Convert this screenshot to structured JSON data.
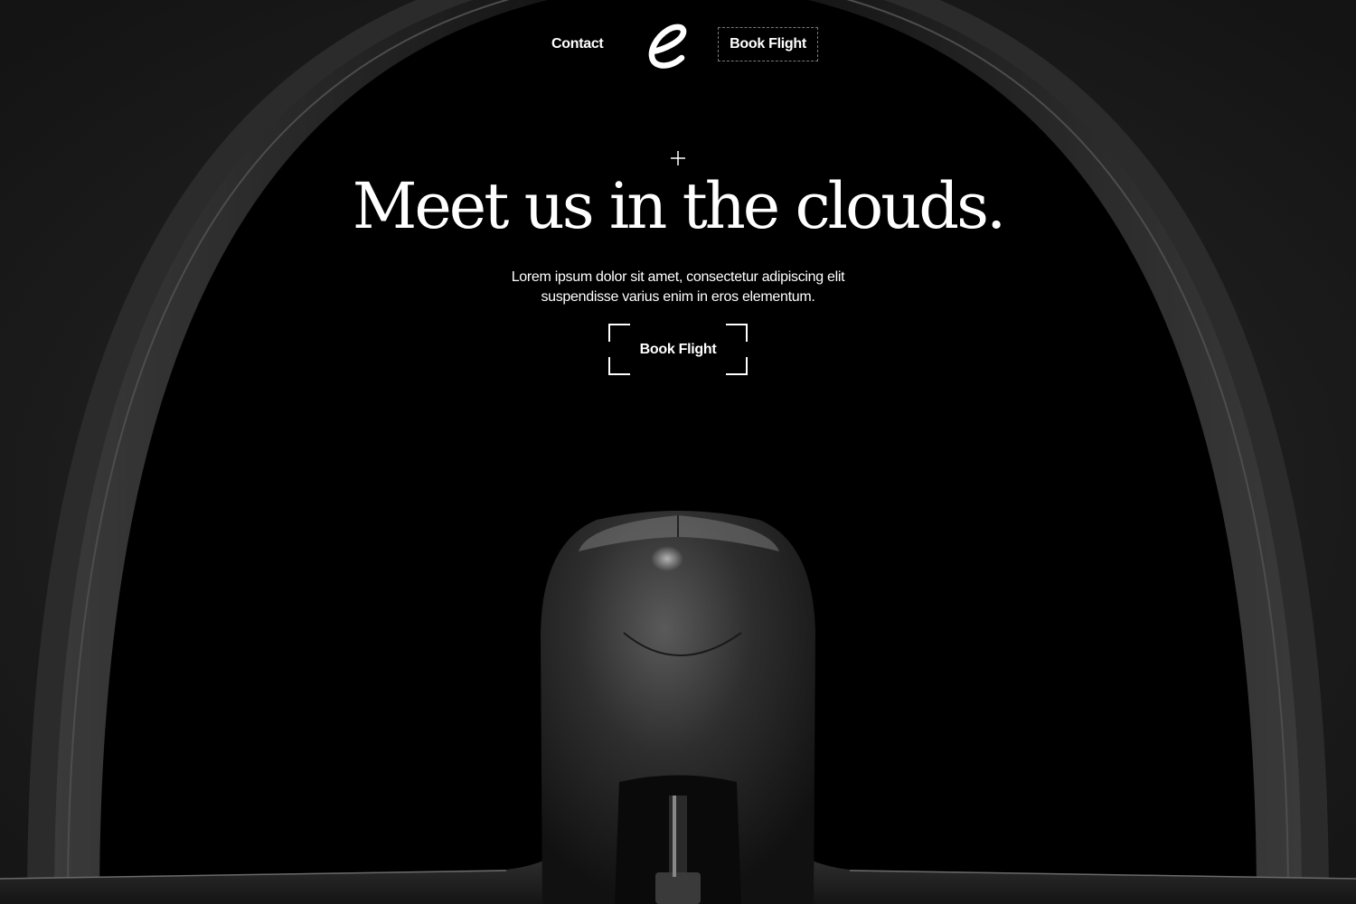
{
  "nav": {
    "contact_label": "Contact",
    "logo_icon": "e-logo-icon",
    "book_label": "Book Flight"
  },
  "hero": {
    "plus_icon": "plus-icon",
    "headline": "Meet us in the clouds.",
    "subtext": "Lorem ipsum dolor sit amet, consectetur adipiscing elit suspendisse varius enim in eros elementum.",
    "cta_label": "Book Flight"
  },
  "colors": {
    "background": "#000000",
    "text": "#ffffff",
    "frame": "#1a1a1a"
  }
}
